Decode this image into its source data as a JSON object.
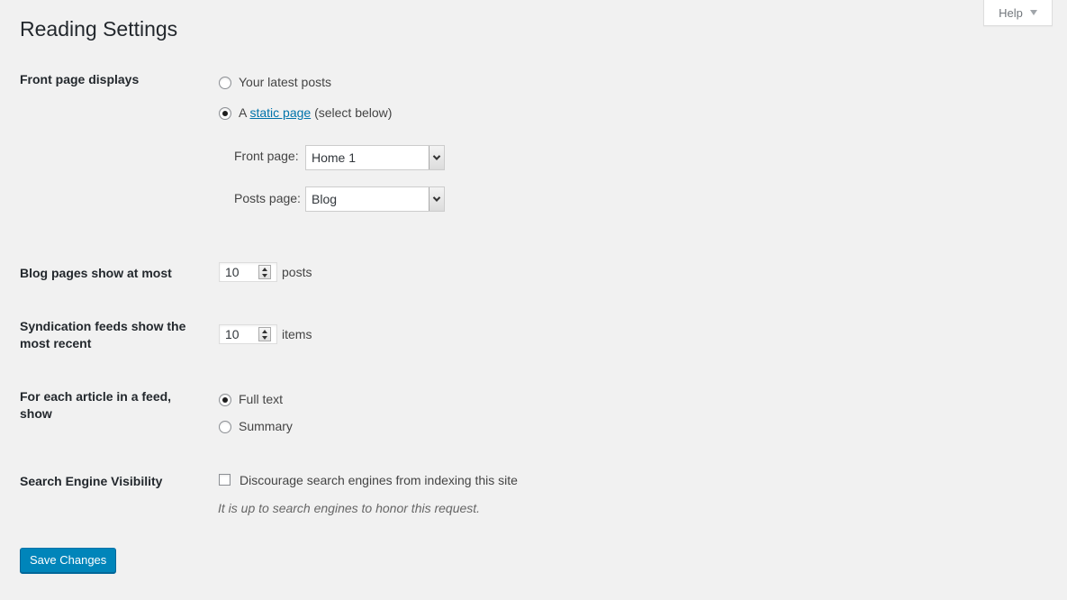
{
  "help": {
    "label": "Help"
  },
  "page": {
    "title": "Reading Settings"
  },
  "front_page": {
    "label": "Front page displays",
    "option_latest": "Your latest posts",
    "option_static_prefix": "A",
    "option_static_link": "static page",
    "option_static_suffix": "(select below)",
    "selected": "static",
    "front_label": "Front page:",
    "front_value": "Home 1",
    "posts_label": "Posts page:",
    "posts_value": "Blog"
  },
  "blog_pages": {
    "label": "Blog pages show at most",
    "value": "10",
    "unit": "posts"
  },
  "syndication": {
    "label": "Syndication feeds show the most recent",
    "value": "10",
    "unit": "items"
  },
  "feed_article": {
    "label": "For each article in a feed, show",
    "option_full": "Full text",
    "option_summary": "Summary",
    "selected": "full"
  },
  "search_engine": {
    "label": "Search Engine Visibility",
    "checkbox_label": "Discourage search engines from indexing this site",
    "checked": false,
    "note": "It is up to search engines to honor this request."
  },
  "actions": {
    "save_label": "Save Changes"
  },
  "colors": {
    "background": "#f1f1f1",
    "primary_button": "#0085ba",
    "link": "#0073aa"
  }
}
